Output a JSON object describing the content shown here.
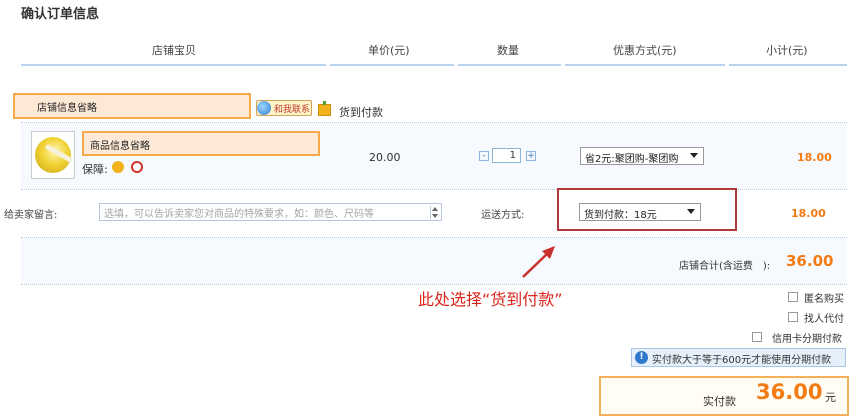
{
  "page_title": "确认订单信息",
  "table_headers": [
    "店铺宝贝",
    "单价(元)",
    "数量",
    "优惠方式(元)",
    "小计(元)"
  ],
  "shop": {
    "name": "店铺信息省略",
    "contact_label": "和我联系",
    "payment_method": "货到付款"
  },
  "item": {
    "name": "商品信息省略",
    "guarantee_label": "保障:",
    "unit_price": "20.00",
    "quantity": "1",
    "minus": "-",
    "plus": "+",
    "discount_option": "省2元:聚团购-聚团购",
    "subtotal": "18.00"
  },
  "message": {
    "label": "给卖家留言:",
    "placeholder": "选填，可以告诉卖家您对商品的特殊要求，如：颜色、尺码等"
  },
  "shipping": {
    "label": "运送方式:",
    "selected": "货到付款：18元",
    "subtotal": "18.00"
  },
  "shop_total": {
    "label": "店铺合计(含运费　):",
    "value": "36.00"
  },
  "annotation": "此处选择“货到付款”",
  "options": {
    "anonymous": "匿名购买",
    "proxy_pay": "找人代付",
    "installment": "信用卡分期付款"
  },
  "notice": "实付款大于等于600元才能使用分期付款",
  "payment": {
    "label": "实付款",
    "value": "36.00",
    "unit": "元"
  },
  "colors": {
    "accent_orange": "#f27b13",
    "header_line": "#b7d3ee",
    "highlight_box": "#f5a94a",
    "annotation_red": "#d9261c"
  }
}
